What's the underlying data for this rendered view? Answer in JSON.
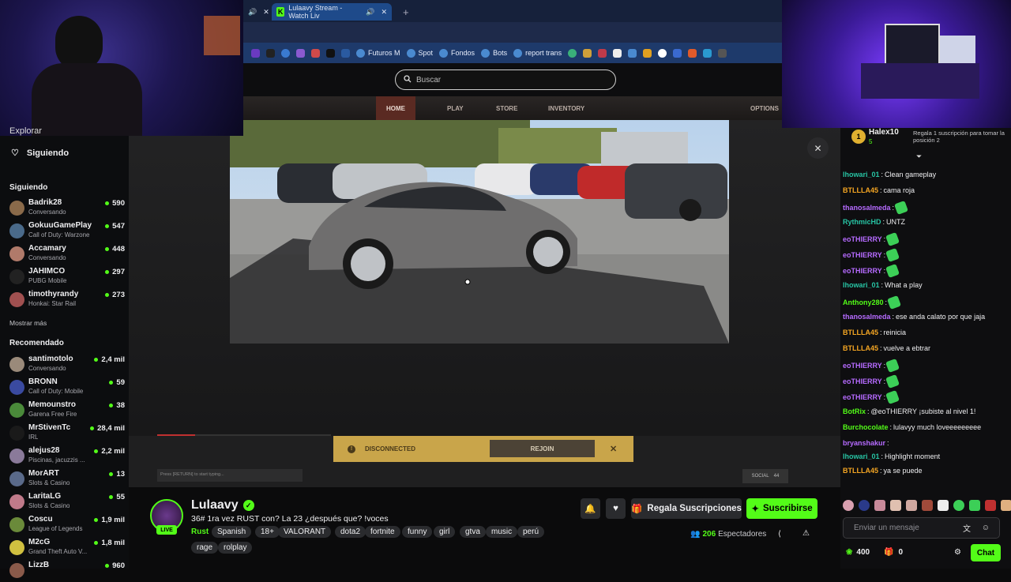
{
  "browser": {
    "tabs": [
      {
        "label": "✕"
      },
      {
        "label": "Lulaavy Stream - Watch Liv"
      }
    ],
    "new_tab": "+",
    "bookmarks": [
      "Futuros M",
      "Spot",
      "Fondos",
      "Bots",
      "report trans"
    ]
  },
  "header": {
    "search_placeholder": "Buscar"
  },
  "game_nav": [
    "HOME",
    "PLAY",
    "STORE",
    "INVENTORY",
    "OPTIONS"
  ],
  "game_overlay": {
    "disconnected": "DISCONNECTED",
    "rejoin": "REJOIN",
    "typing_placeholder": "Press [RETURN] to start typing...",
    "social": "SOCIAL",
    "social_count": "44"
  },
  "sidebar": {
    "explore": "Explorar",
    "following_nav": "Siguiendo",
    "following_title": "Siguiendo",
    "show_more": "Mostrar más",
    "recommended_title": "Recomendado",
    "following": [
      {
        "name": "Badrik28",
        "game": "Conversando",
        "count": "590",
        "color": "#8a6a4a"
      },
      {
        "name": "GokuuGamePlay",
        "game": "Call of Duty: Warzone",
        "count": "547",
        "color": "#4a6a8a"
      },
      {
        "name": "Accamary",
        "game": "Conversando",
        "count": "448",
        "color": "#b07a6a"
      },
      {
        "name": "JAHIMCO",
        "game": "PUBG Mobile",
        "count": "297",
        "color": "#222222"
      },
      {
        "name": "timothyrandy",
        "game": "Honkai: Star Rail",
        "count": "273",
        "color": "#a05050"
      }
    ],
    "recommended": [
      {
        "name": "santimotolo",
        "game": "Conversando",
        "count": "2,4 mil",
        "color": "#9a8a7a"
      },
      {
        "name": "BRONN",
        "game": "Call of Duty: Mobile",
        "count": "59",
        "color": "#3a4aa0"
      },
      {
        "name": "Memounstro",
        "game": "Garena Free Fire",
        "count": "38",
        "color": "#4a8a3a"
      },
      {
        "name": "MrStivenTc",
        "game": "IRL",
        "count": "28,4 mil",
        "color": "#1a1a1a"
      },
      {
        "name": "alejus28",
        "game": "Piscinas, jacuzzis ...",
        "count": "2,2 mil",
        "color": "#8a7a9a"
      },
      {
        "name": "MorART",
        "game": "Slots & Casino",
        "count": "13",
        "color": "#5a6a8a"
      },
      {
        "name": "LaritaLG",
        "game": "Slots & Casino",
        "count": "55",
        "color": "#c07a8a"
      },
      {
        "name": "Coscu",
        "game": "League of Legends",
        "count": "1,9 mil",
        "color": "#6a8a3a"
      },
      {
        "name": "M2cG",
        "game": "Grand Theft Auto V...",
        "count": "1,8 mil",
        "color": "#d0c040"
      },
      {
        "name": "LizzB",
        "game": "",
        "count": "960",
        "color": "#8a5a4a"
      }
    ]
  },
  "stream": {
    "streamer": "Lulaavy",
    "live": "LIVE",
    "title": "36# 1ra vez RUST con? La 23 ¿después que? !voces",
    "category": "Rust",
    "tags": [
      "Spanish",
      "18+",
      "VALORANT",
      "dota2",
      "fortnite",
      "funny",
      "girl",
      "gtva",
      "music",
      "perú",
      "rage",
      "rolplay"
    ],
    "gift_button": "Regala Suscripciones",
    "subscribe_button": "Suscribirse",
    "viewers_count": "206",
    "viewers_label": "Espectadores"
  },
  "chat": {
    "pinned_user": "Halex10",
    "pinned_rank": "1",
    "pinned_points": "5",
    "pinned_text": "Regala 1 suscripción para tomar la posición 2",
    "messages": [
      {
        "user": "lhowari_01",
        "color": "#27c4a4",
        "text": "Clean gameplay",
        "emote": false
      },
      {
        "user": "BTLLLA45",
        "color": "#f5a623",
        "text": "cama roja",
        "emote": false
      },
      {
        "user": "thanosalmeda",
        "color": "#b66bff",
        "text": "",
        "emote": true
      },
      {
        "user": "RythmicHD",
        "color": "#27c4a4",
        "text": "UNTZ",
        "emote": false
      },
      {
        "user": "eoTHIERRY",
        "color": "#b66bff",
        "text": "",
        "emote": true
      },
      {
        "user": "eoTHIERRY",
        "color": "#b66bff",
        "text": "",
        "emote": true
      },
      {
        "user": "eoTHIERRY",
        "color": "#b66bff",
        "text": "",
        "emote": true
      },
      {
        "user": "lhowari_01",
        "color": "#27c4a4",
        "text": "What a play",
        "emote": false
      },
      {
        "user": "Anthony280",
        "color": "#53fc18",
        "text": "",
        "emote": true
      },
      {
        "user": "thanosalmeda",
        "color": "#b66bff",
        "text": "ese anda calato por que jaja",
        "emote": false
      },
      {
        "user": "BTLLLA45",
        "color": "#f5a623",
        "text": "reinicia",
        "emote": false
      },
      {
        "user": "BTLLLA45",
        "color": "#f5a623",
        "text": "vuelve a ebtrar",
        "emote": false
      },
      {
        "user": "eoTHIERRY",
        "color": "#b66bff",
        "text": "",
        "emote": true
      },
      {
        "user": "eoTHIERRY",
        "color": "#b66bff",
        "text": "",
        "emote": true
      },
      {
        "user": "eoTHIERRY",
        "color": "#b66bff",
        "text": "",
        "emote": true
      },
      {
        "user": "BotRix",
        "color": "#53fc18",
        "text": "@eoTHIERRY ¡subiste al nivel 1!",
        "emote": false
      },
      {
        "user": "Burchocolate",
        "color": "#53fc18",
        "text": "lulavyy much loveeeeeeeee",
        "emote": false
      },
      {
        "user": "bryanshakur",
        "color": "#b66bff",
        "text": "",
        "emote": false
      },
      {
        "user": "lhowari_01",
        "color": "#27c4a4",
        "text": "Highlight moment",
        "emote": false
      },
      {
        "user": "BTLLLA45",
        "color": "#f5a623",
        "text": "ya se puede",
        "emote": false
      }
    ],
    "input_placeholder": "Enviar un mensaje",
    "points": "400",
    "gifts": "0",
    "send": "Chat"
  }
}
